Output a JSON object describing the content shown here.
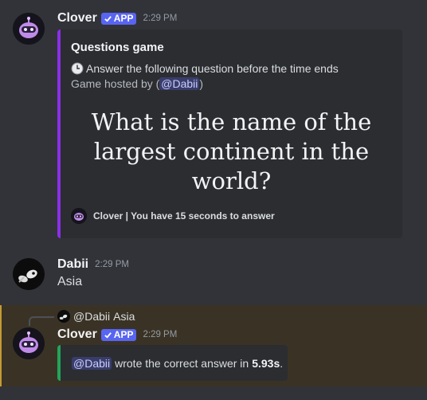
{
  "messages": [
    {
      "author": "Clover",
      "badge": "APP",
      "time": "2:29 PM",
      "embed": {
        "title": "Questions game",
        "line1": "Answer the following question before the time ends",
        "hosted_prefix": "Game hosted by (",
        "hosted_mention": "@Dabii",
        "hosted_suffix": ")",
        "question": "What is the name of the largest continent in the world?",
        "footer": "Clover | You have 15 seconds to answer"
      }
    },
    {
      "author": "Dabii",
      "time": "2:29 PM",
      "content": "Asia"
    },
    {
      "reply": {
        "mention": "@Dabii",
        "text": "Asia"
      },
      "author": "Clover",
      "badge": "APP",
      "time": "2:29 PM",
      "embed": {
        "mention": "@Dabii",
        "text": "wrote the correct answer in",
        "value": "5.93s",
        "end": "."
      }
    }
  ],
  "colors": {
    "background": "#313338",
    "embed_bg": "#2b2d31",
    "embed1_accent": "#8b2ee8",
    "embed2_accent": "#23a55a",
    "app_badge": "#5865f2",
    "highlight_bg": "#3a3325",
    "highlight_border": "#c59b34"
  },
  "icons": {
    "bot_avatar": "robot-avatar-icon",
    "user_avatar": "panda-avatar-icon",
    "clock": "clock-icon",
    "checkmark": "checkmark-icon"
  }
}
